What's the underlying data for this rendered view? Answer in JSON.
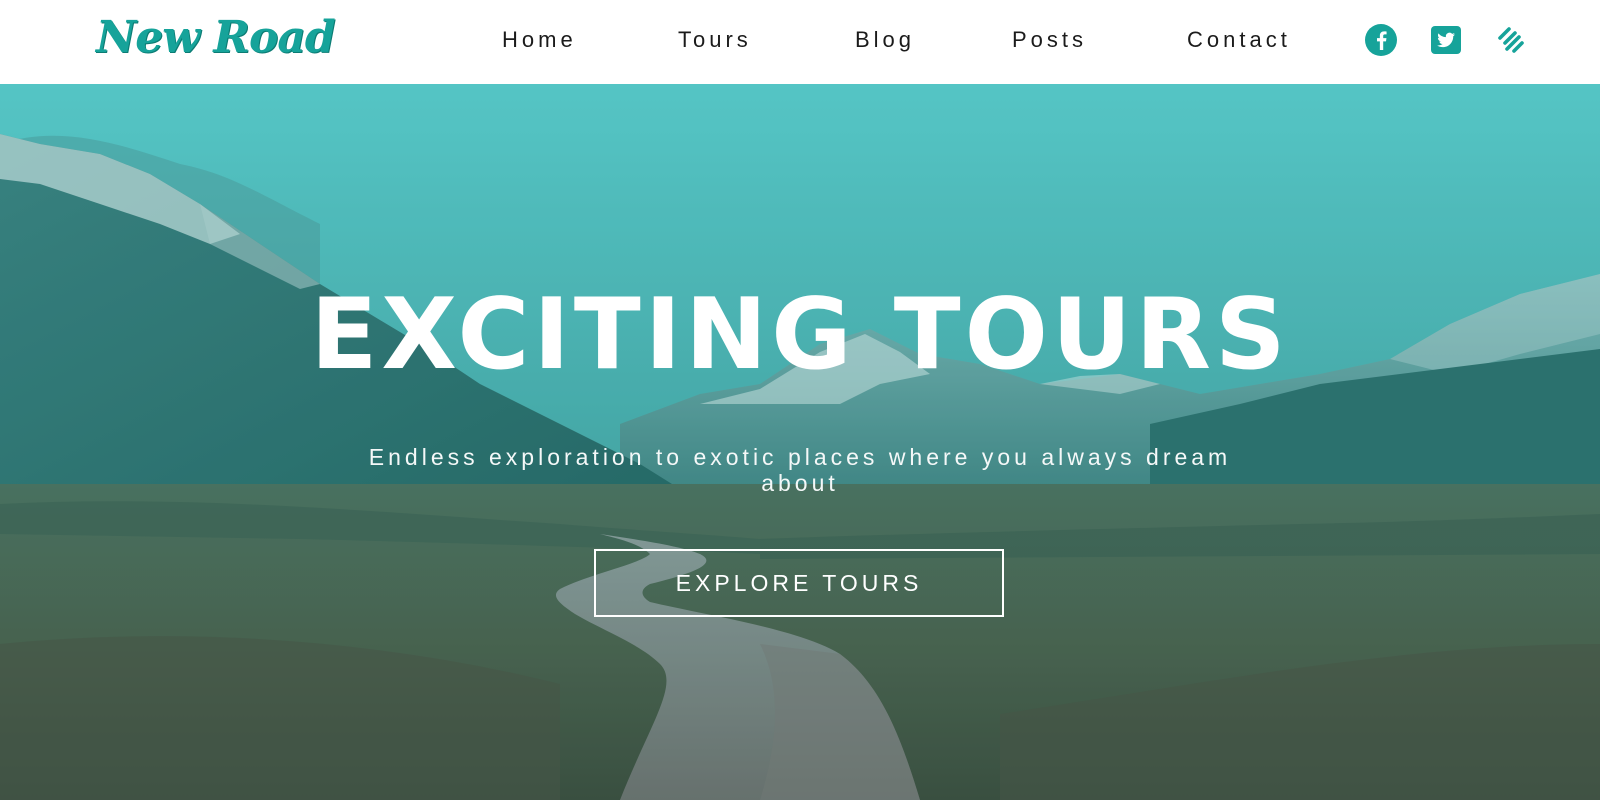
{
  "brand": {
    "logo_text": "New Road",
    "color": "#16a39a"
  },
  "nav": {
    "items": [
      {
        "label": "Home"
      },
      {
        "label": "Tours"
      },
      {
        "label": "Blog"
      },
      {
        "label": "Posts"
      },
      {
        "label": "Contact"
      }
    ]
  },
  "social": [
    {
      "icon": "facebook-icon"
    },
    {
      "icon": "twitter-icon"
    },
    {
      "icon": "squarespace-icon"
    }
  ],
  "hero": {
    "title": "EXCITING TOURS",
    "subtitle": "Endless exploration to exotic places where you always dream about",
    "button_label": "EXPLORE TOURS",
    "overlay_color": "#2aa8a4"
  },
  "colors": {
    "accent": "#16a39a",
    "nav_text": "#1b1b1b",
    "hero_text": "#ffffff"
  }
}
